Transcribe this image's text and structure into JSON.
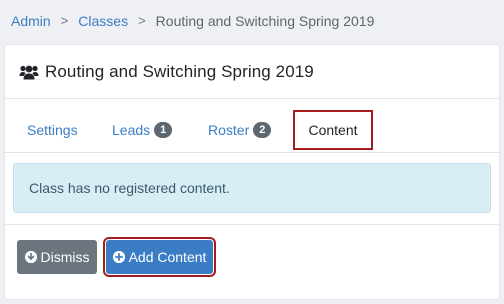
{
  "breadcrumb": {
    "items": [
      "Admin",
      "Classes"
    ],
    "current": "Routing and Switching Spring 2019",
    "separator": ">"
  },
  "card": {
    "title": "Routing and Switching Spring 2019",
    "icon": "users-icon"
  },
  "tabs": {
    "settings": {
      "label": "Settings"
    },
    "leads": {
      "label": "Leads",
      "badge": "1"
    },
    "roster": {
      "label": "Roster",
      "badge": "2"
    },
    "content": {
      "label": "Content",
      "active": true
    }
  },
  "alert": {
    "text": "Class has no registered content."
  },
  "buttons": {
    "dismiss": {
      "label": "Dismiss",
      "icon": "arrow-down-circle-icon"
    },
    "add": {
      "label": "Add Content",
      "icon": "plus-circle-icon"
    }
  },
  "colors": {
    "link": "#3b7dc4",
    "highlight_border": "#a51c1c",
    "alert_bg": "#d9edf5",
    "badge_bg": "#5c6770",
    "dismiss_bg": "#6c757d",
    "primary_bg": "#3b7dc4"
  }
}
